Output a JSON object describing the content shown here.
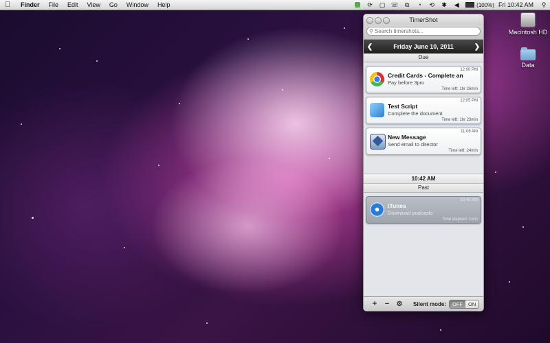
{
  "menubar": {
    "app": "Finder",
    "menus": [
      "File",
      "Edit",
      "View",
      "Go",
      "Window",
      "Help"
    ],
    "battery": "(100%)",
    "clock": "Fri 10:42 AM"
  },
  "desktop": {
    "icons": [
      {
        "label": "Macintosh HD",
        "icon": "hard-drive-icon"
      },
      {
        "label": "Data",
        "icon": "folder-icon"
      }
    ]
  },
  "window": {
    "title": "TimerShot",
    "search_placeholder": "Search timershots...",
    "date": "Friday June 10, 2011",
    "due_label": "Due",
    "now_time": "10:42 AM",
    "past_label": "Past",
    "due_items": [
      {
        "time": "12:00 PM",
        "title": "Credit Cards - Complete an Online...",
        "subtitle": "Pay before 3pm",
        "remaining": "Time left: 1hr 26min",
        "icon": "chrome-icon"
      },
      {
        "time": "12:05 PM",
        "title": "Test Script",
        "subtitle": "Complete the document",
        "remaining": "Time left: 1hr 23min",
        "icon": "script-app-icon"
      },
      {
        "time": "11:06 AM",
        "title": "New Message",
        "subtitle": "Send email to director",
        "remaining": "Time left: 24min",
        "icon": "mail-icon"
      }
    ],
    "past_items": [
      {
        "time": "10:40 AM",
        "title": "iTunes",
        "subtitle": "Download podcasts",
        "elapsed": "Time elapsed: 1min",
        "icon": "itunes-icon"
      }
    ],
    "footer": {
      "add": "+",
      "remove": "−",
      "settings": "⚙",
      "silent_label": "Silent mode:",
      "off": "OFF",
      "on": "ON"
    }
  }
}
